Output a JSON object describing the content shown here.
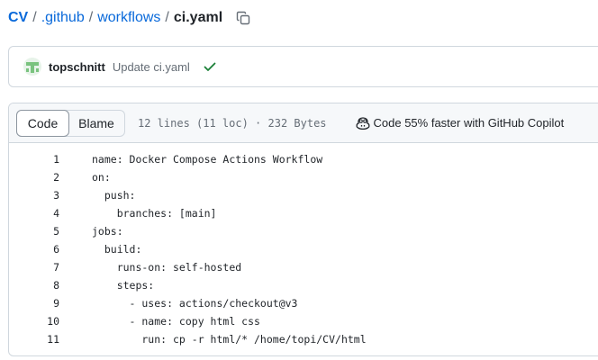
{
  "breadcrumb": {
    "root": "CV",
    "dir1": ".github",
    "dir2": "workflows",
    "file": "ci.yaml",
    "separator": "/"
  },
  "commit": {
    "author": "topschnitt",
    "message": "Update ci.yaml",
    "status": "success"
  },
  "file_header": {
    "tabs": [
      {
        "label": "Code"
      },
      {
        "label": "Blame"
      }
    ],
    "info": "12 lines (11 loc) · 232 Bytes",
    "copilot_label": "Code 55% faster with GitHub Copilot"
  },
  "code": {
    "lines": [
      {
        "num": "1",
        "text": "name: Docker Compose Actions Workflow"
      },
      {
        "num": "2",
        "text": "on:"
      },
      {
        "num": "3",
        "text": "  push:"
      },
      {
        "num": "4",
        "text": "    branches: [main]"
      },
      {
        "num": "5",
        "text": "jobs:"
      },
      {
        "num": "6",
        "text": "  build:"
      },
      {
        "num": "7",
        "text": "    runs-on: self-hosted"
      },
      {
        "num": "8",
        "text": "    steps:"
      },
      {
        "num": "9",
        "text": "      - uses: actions/checkout@v3"
      },
      {
        "num": "10",
        "text": "      - name: copy html css"
      },
      {
        "num": "11",
        "text": "        run: cp -r html/* /home/topi/CV/html"
      }
    ]
  },
  "colors": {
    "link": "#0969da",
    "success": "#1a7f37",
    "border": "#d0d7de",
    "muted": "#656d76"
  },
  "icons": {
    "copy": "copy-icon",
    "check": "check-icon",
    "copilot": "copilot-icon",
    "avatar": "avatar"
  }
}
